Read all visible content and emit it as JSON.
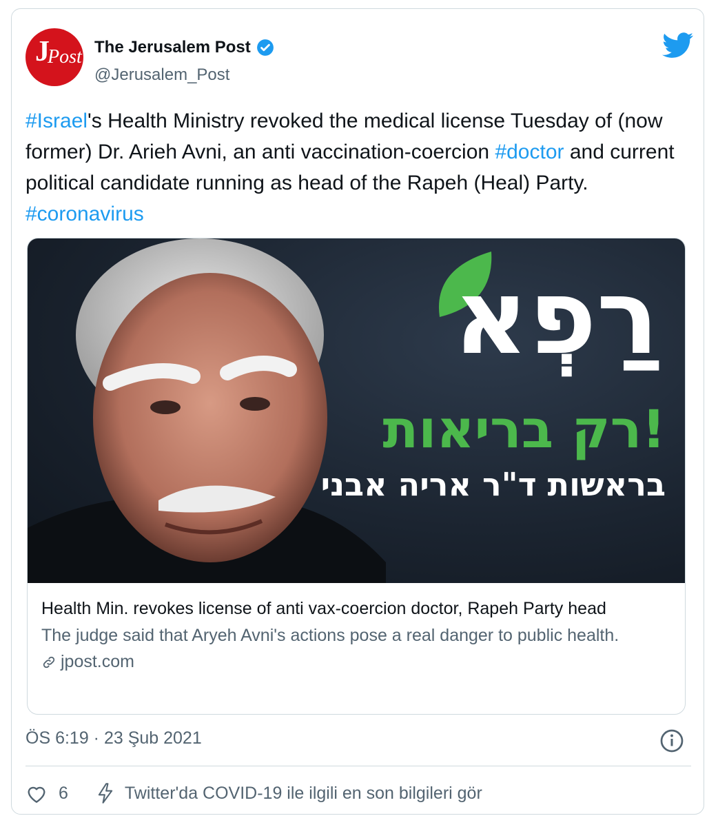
{
  "colors": {
    "accent": "#1d9bf0",
    "text_primary": "#0f1419",
    "text_secondary": "#536471",
    "border": "#cfd9de",
    "brand_red": "#d4131c",
    "poster_green": "#4cb84c"
  },
  "author": {
    "avatar_j": "J",
    "avatar_post": "Post",
    "name": "The Jerusalem Post",
    "handle": "@Jerusalem_Post",
    "verified_icon": "verified-badge-icon",
    "platform_icon": "twitter-bird-icon"
  },
  "tweet": {
    "seg1": "#Israel",
    "seg2": "'s Health Ministry revoked the medical license Tuesday of (now former) Dr. Arieh Avni, an anti vaccination-coercion ",
    "seg3": "#doctor",
    "seg4": " and current political candidate running as head of the Rapeh (Heal) Party. ",
    "seg5": "#coronavirus"
  },
  "poster": {
    "logo": "רַפְא",
    "slogan": "רק בריאות!",
    "subline": "בראשות ד\"ר אריה אבני"
  },
  "link_card": {
    "title": "Health Min. revokes license of anti vax-coercion doctor, Rapeh Party head",
    "description": "The judge said that Aryeh Avni's actions pose a real danger to public health.",
    "domain": "jpost.com",
    "domain_icon": "link-icon"
  },
  "meta": {
    "timestamp": "ÖS 6:19 · 23 Şub 2021",
    "info_icon": "info-icon"
  },
  "actions": {
    "like_count": "6",
    "like_icon": "heart-icon",
    "covid_icon": "lightning-icon",
    "covid_text": "Twitter'da COVID-19 ile ilgili en son bilgileri gör"
  }
}
